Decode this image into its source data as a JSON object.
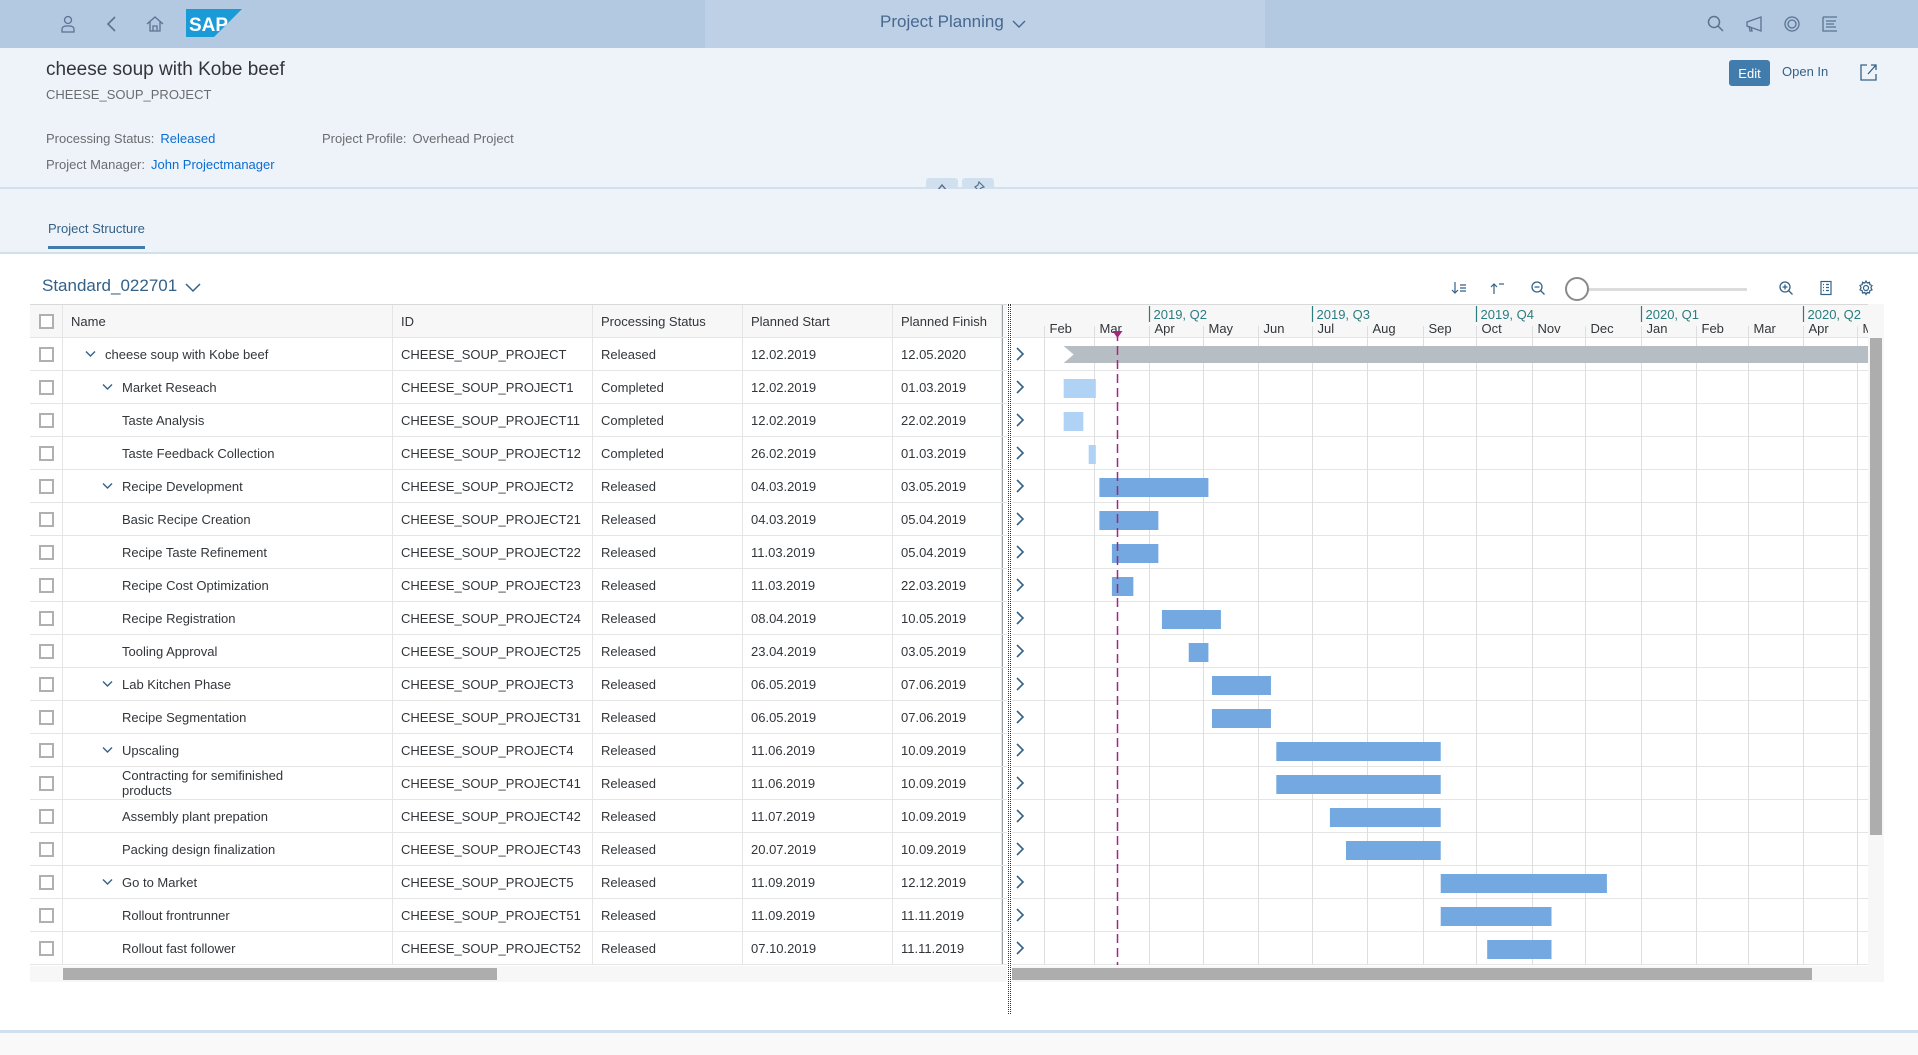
{
  "shell": {
    "title": "Project Planning",
    "logo_text": "SAP",
    "left_icons": [
      "user-icon",
      "back-icon",
      "home-icon"
    ],
    "right_icons": [
      "search-icon",
      "notifications-icon",
      "copilot-icon",
      "menu-icon"
    ]
  },
  "object_header": {
    "title": "cheese soup with Kobe beef",
    "subtitle": "CHEESE_SOUP_PROJECT",
    "processing_status_label": "Processing Status:",
    "processing_status_value": "Released",
    "project_profile_label": "Project Profile:",
    "project_profile_value": "Overhead Project",
    "project_manager_label": "Project Manager:",
    "project_manager_value": "John Projectmanager",
    "edit_label": "Edit",
    "open_in_label": "Open In"
  },
  "tabs": [
    {
      "label": "Project Structure",
      "selected": true
    }
  ],
  "variant": {
    "name": "Standard_022701"
  },
  "table": {
    "columns": [
      "Name",
      "ID",
      "Processing Status",
      "Planned Start",
      "Planned Finish"
    ],
    "rows": [
      {
        "level": 0,
        "expandable": true,
        "name": "cheese soup with Kobe beef",
        "id": "CHEESE_SOUP_PROJECT",
        "status": "Released",
        "start": "12.02.2019",
        "finish": "12.05.2020"
      },
      {
        "level": 1,
        "expandable": true,
        "name": "Market Reseach",
        "id": "CHEESE_SOUP_PROJECT1",
        "status": "Completed",
        "start": "12.02.2019",
        "finish": "01.03.2019"
      },
      {
        "level": 2,
        "expandable": false,
        "name": "Taste Analysis",
        "id": "CHEESE_SOUP_PROJECT11",
        "status": "Completed",
        "start": "12.02.2019",
        "finish": "22.02.2019"
      },
      {
        "level": 2,
        "expandable": false,
        "name": "Taste Feedback Collection",
        "id": "CHEESE_SOUP_PROJECT12",
        "status": "Completed",
        "start": "26.02.2019",
        "finish": "01.03.2019"
      },
      {
        "level": 1,
        "expandable": true,
        "name": "Recipe Development",
        "id": "CHEESE_SOUP_PROJECT2",
        "status": "Released",
        "start": "04.03.2019",
        "finish": "03.05.2019"
      },
      {
        "level": 2,
        "expandable": false,
        "name": "Basic Recipe Creation",
        "id": "CHEESE_SOUP_PROJECT21",
        "status": "Released",
        "start": "04.03.2019",
        "finish": "05.04.2019"
      },
      {
        "level": 2,
        "expandable": false,
        "name": "Recipe Taste Refinement",
        "id": "CHEESE_SOUP_PROJECT22",
        "status": "Released",
        "start": "11.03.2019",
        "finish": "05.04.2019"
      },
      {
        "level": 2,
        "expandable": false,
        "name": "Recipe Cost Optimization",
        "id": "CHEESE_SOUP_PROJECT23",
        "status": "Released",
        "start": "11.03.2019",
        "finish": "22.03.2019"
      },
      {
        "level": 2,
        "expandable": false,
        "name": "Recipe Registration",
        "id": "CHEESE_SOUP_PROJECT24",
        "status": "Released",
        "start": "08.04.2019",
        "finish": "10.05.2019"
      },
      {
        "level": 2,
        "expandable": false,
        "name": "Tooling Approval",
        "id": "CHEESE_SOUP_PROJECT25",
        "status": "Released",
        "start": "23.04.2019",
        "finish": "03.05.2019"
      },
      {
        "level": 1,
        "expandable": true,
        "name": "Lab Kitchen Phase",
        "id": "CHEESE_SOUP_PROJECT3",
        "status": "Released",
        "start": "06.05.2019",
        "finish": "07.06.2019"
      },
      {
        "level": 2,
        "expandable": false,
        "name": "Recipe Segmentation",
        "id": "CHEESE_SOUP_PROJECT31",
        "status": "Released",
        "start": "06.05.2019",
        "finish": "07.06.2019"
      },
      {
        "level": 1,
        "expandable": true,
        "name": "Upscaling",
        "id": "CHEESE_SOUP_PROJECT4",
        "status": "Released",
        "start": "11.06.2019",
        "finish": "10.09.2019"
      },
      {
        "level": 2,
        "expandable": false,
        "name": "Contracting for semifinished products",
        "id": "CHEESE_SOUP_PROJECT41",
        "status": "Released",
        "start": "11.06.2019",
        "finish": "10.09.2019"
      },
      {
        "level": 2,
        "expandable": false,
        "name": "Assembly plant prepation",
        "id": "CHEESE_SOUP_PROJECT42",
        "status": "Released",
        "start": "11.07.2019",
        "finish": "10.09.2019"
      },
      {
        "level": 2,
        "expandable": false,
        "name": "Packing design finalization",
        "id": "CHEESE_SOUP_PROJECT43",
        "status": "Released",
        "start": "20.07.2019",
        "finish": "10.09.2019"
      },
      {
        "level": 1,
        "expandable": true,
        "name": "Go to Market",
        "id": "CHEESE_SOUP_PROJECT5",
        "status": "Released",
        "start": "11.09.2019",
        "finish": "12.12.2019"
      },
      {
        "level": 2,
        "expandable": false,
        "name": "Rollout frontrunner",
        "id": "CHEESE_SOUP_PROJECT51",
        "status": "Released",
        "start": "11.09.2019",
        "finish": "11.11.2019"
      },
      {
        "level": 2,
        "expandable": false,
        "name": "Rollout fast follower",
        "id": "CHEESE_SOUP_PROJECT52",
        "status": "Released",
        "start": "07.10.2019",
        "finish": "11.11.2019"
      }
    ]
  },
  "gantt": {
    "quarters": [
      {
        "label": "2019, Q2",
        "date": "2019-04-01"
      },
      {
        "label": "2019, Q3",
        "date": "2019-07-01"
      },
      {
        "label": "2019, Q4",
        "date": "2019-10-01"
      },
      {
        "label": "2020, Q1",
        "date": "2020-01-01"
      },
      {
        "label": "2020, Q2",
        "date": "2020-04-01"
      }
    ],
    "months": [
      {
        "label": "Feb",
        "date": "2019-02-01"
      },
      {
        "label": "Mar",
        "date": "2019-03-01"
      },
      {
        "label": "Apr",
        "date": "2019-04-01"
      },
      {
        "label": "May",
        "date": "2019-05-01"
      },
      {
        "label": "Jun",
        "date": "2019-06-01"
      },
      {
        "label": "Jul",
        "date": "2019-07-01"
      },
      {
        "label": "Aug",
        "date": "2019-08-01"
      },
      {
        "label": "Sep",
        "date": "2019-09-01"
      },
      {
        "label": "Oct",
        "date": "2019-10-01"
      },
      {
        "label": "Nov",
        "date": "2019-11-01"
      },
      {
        "label": "Dec",
        "date": "2019-12-01"
      },
      {
        "label": "Jan",
        "date": "2020-01-01"
      },
      {
        "label": "Feb",
        "date": "2020-02-01"
      },
      {
        "label": "Mar",
        "date": "2020-03-01"
      },
      {
        "label": "Apr",
        "date": "2020-04-01"
      },
      {
        "label": "M",
        "date": "2020-05-01"
      }
    ],
    "today": "2019-03-14",
    "colors": {
      "released": "#73a9e0",
      "completed": "#b0d2f5",
      "summary": "#b6bec3",
      "today": "#a3257c",
      "quarter_label": "#2b7c7f"
    }
  },
  "toolbar": {
    "icons": [
      "expand-all-icon",
      "collapse-all-icon",
      "zoom-out-icon",
      "zoom-in-icon",
      "table-settings-icon",
      "settings-icon"
    ],
    "zoom_level": 0
  }
}
